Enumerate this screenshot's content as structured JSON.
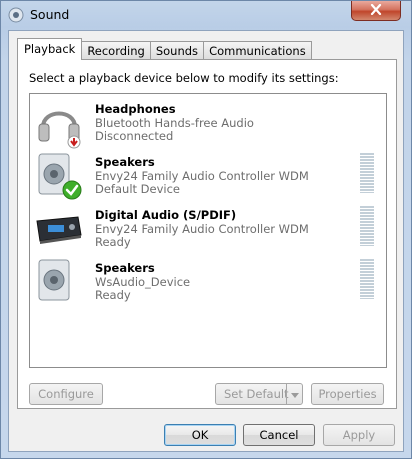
{
  "window": {
    "title": "Sound",
    "close_icon": "close-x-icon"
  },
  "tabs": [
    {
      "label": "Playback",
      "active": true
    },
    {
      "label": "Recording",
      "active": false
    },
    {
      "label": "Sounds",
      "active": false
    },
    {
      "label": "Communications",
      "active": false
    }
  ],
  "panel": {
    "instruction": "Select a playback device below to modify its settings:"
  },
  "devices": [
    {
      "name": "Headphones",
      "driver": "Bluetooth Hands-free Audio",
      "state": "Disconnected",
      "icon": "headphones-icon",
      "badge": "disconnected-arrow-icon"
    },
    {
      "name": "Speakers",
      "driver": "Envy24 Family Audio Controller WDM",
      "state": "Default Device",
      "icon": "speaker-icon",
      "badge": "default-check-icon"
    },
    {
      "name": "Digital Audio (S/PDIF)",
      "driver": "Envy24 Family Audio Controller WDM",
      "state": "Ready",
      "icon": "digital-audio-receiver-icon"
    },
    {
      "name": "Speakers",
      "driver": "WsAudio_Device",
      "state": "Ready",
      "icon": "speaker-icon"
    }
  ],
  "buttons": {
    "configure": "Configure",
    "set_default": "Set Default",
    "properties": "Properties",
    "ok": "OK",
    "cancel": "Cancel",
    "apply": "Apply"
  },
  "colors": {
    "selected_accent": "#3c7fb1",
    "check_green": "#3fae2a",
    "disconnect_red": "#c81e1e",
    "secondary_text": "#6d6d6d"
  }
}
